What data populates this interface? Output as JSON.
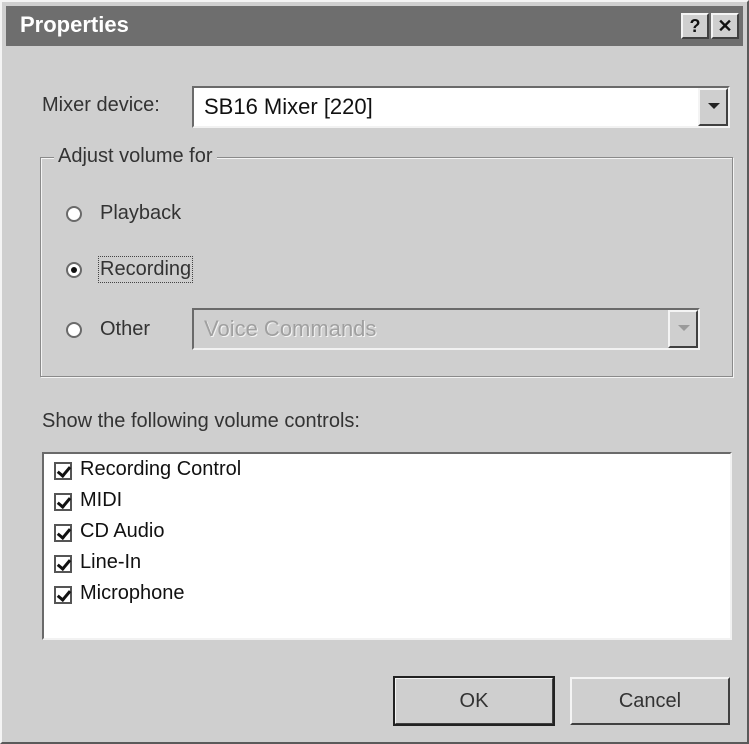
{
  "window": {
    "title": "Properties",
    "help_label": "?",
    "close_label": "✕"
  },
  "mixer": {
    "label": "Mixer device:",
    "value": "SB16 Mixer [220]"
  },
  "adjust": {
    "group_label": "Adjust volume for",
    "options": [
      {
        "label": "Playback",
        "checked": false
      },
      {
        "label": "Recording",
        "checked": true
      },
      {
        "label": "Other",
        "checked": false
      }
    ],
    "other_value": "Voice Commands"
  },
  "controls": {
    "label": "Show the following volume controls:",
    "items": [
      {
        "label": "Recording Control",
        "checked": true
      },
      {
        "label": "MIDI",
        "checked": true
      },
      {
        "label": "CD Audio",
        "checked": true
      },
      {
        "label": "Line-In",
        "checked": true
      },
      {
        "label": "Microphone",
        "checked": true
      }
    ]
  },
  "buttons": {
    "ok": "OK",
    "cancel": "Cancel"
  }
}
